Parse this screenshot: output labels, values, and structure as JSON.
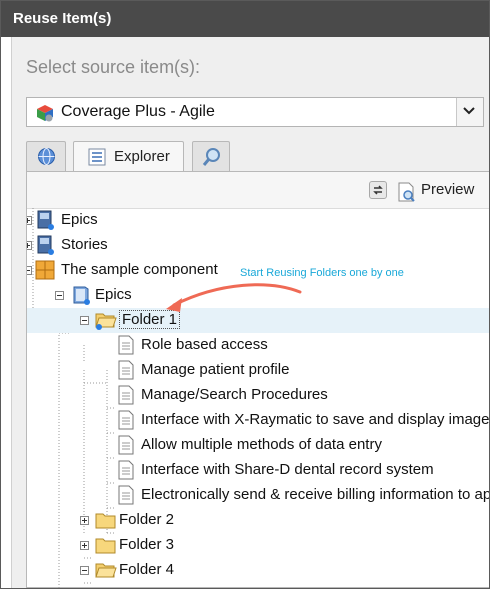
{
  "window": {
    "title": "Reuse Item(s)"
  },
  "source": {
    "label": "Select source item(s):",
    "project": "Coverage Plus - Agile"
  },
  "tabs": {
    "explorer_label": "Explorer"
  },
  "toolbar": {
    "preview_label": "Preview"
  },
  "tree": {
    "top_epics": "Epics",
    "stories": "Stories",
    "component": "The sample component",
    "component_epics": "Epics",
    "folder1": "Folder 1",
    "items": [
      "Role based access",
      "Manage patient profile",
      "Manage/Search Procedures",
      "Interface with X-Raymatic to save and display images",
      "Allow multiple methods of data entry",
      "Interface with Share-D dental record system",
      "Electronically send & receive billing information to ap"
    ],
    "folder2": "Folder 2",
    "folder3": "Folder 3",
    "folder4": "Folder 4"
  },
  "annotation": {
    "text": "Start Reusing Folders one by one"
  },
  "colors": {
    "titlebar": "#4a4a4a",
    "selection": "#e6f2f9",
    "annotation_text": "#19a8d8",
    "annotation_arrow": "#ef6a55"
  }
}
